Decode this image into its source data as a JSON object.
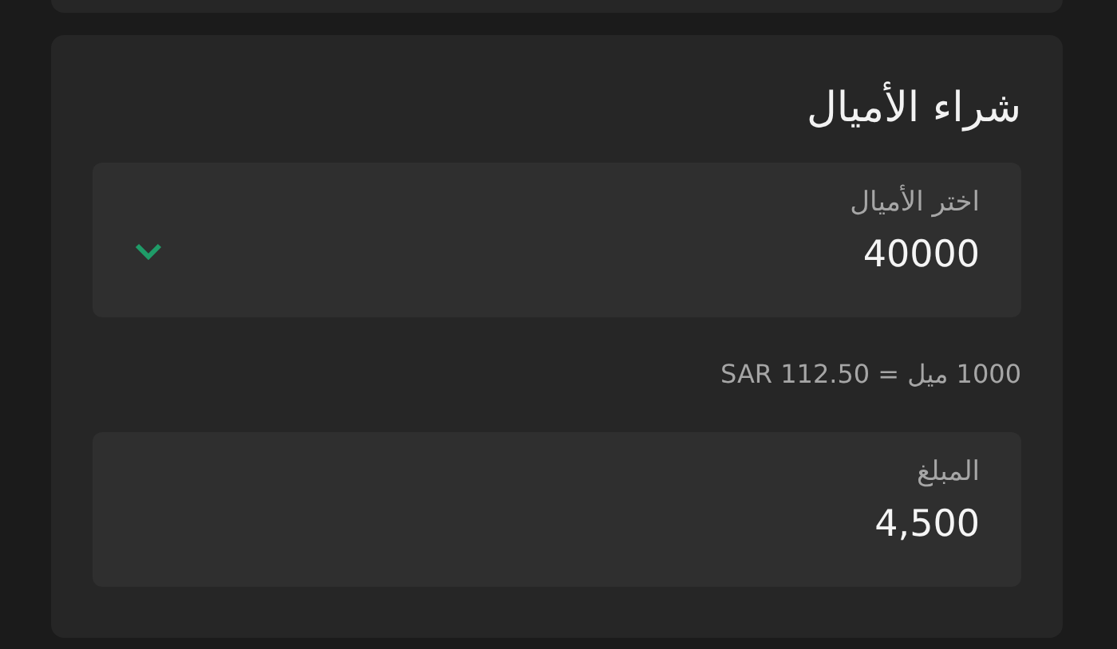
{
  "title": "شراء الأميال",
  "miles_select": {
    "label": "اختر الأميال",
    "value": "40000"
  },
  "rate": "1000 ميل = SAR 112.50",
  "amount_field": {
    "label": "المبلغ",
    "value": "4,500"
  }
}
